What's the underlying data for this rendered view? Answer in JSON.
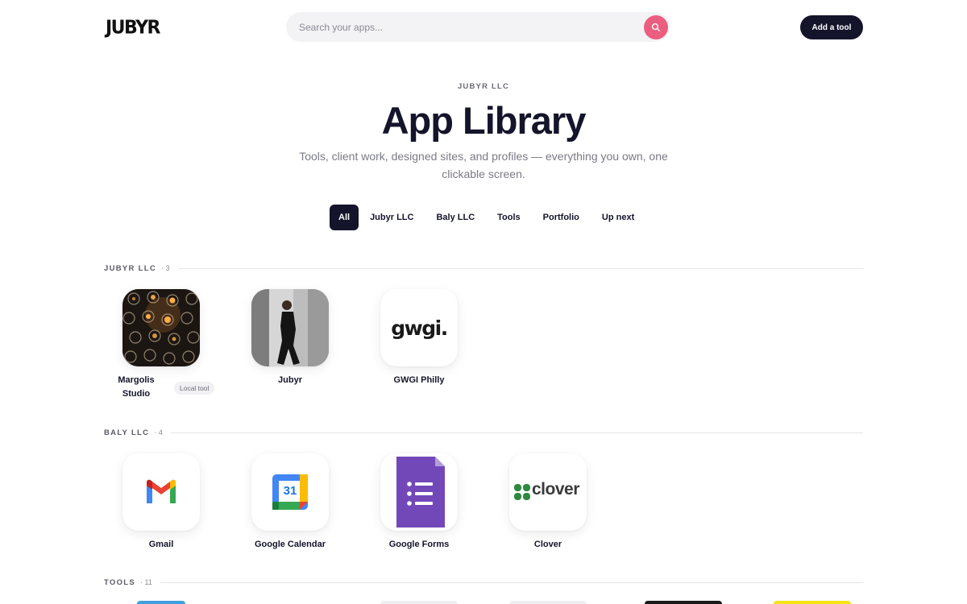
{
  "header": {
    "logo": "JUBYR",
    "search_placeholder": "Search your apps...",
    "add_button": "Add a tool"
  },
  "hero": {
    "eyebrow": "JUBYR LLC",
    "title": "App Library",
    "subtitle": "Tools, client work, designed sites, and profiles — everything you own, one clickable screen."
  },
  "filters": [
    {
      "label": "All",
      "active": true
    },
    {
      "label": "Jubyr LLC",
      "active": false
    },
    {
      "label": "Baly LLC",
      "active": false
    },
    {
      "label": "Tools",
      "active": false
    },
    {
      "label": "Portfolio",
      "active": false
    },
    {
      "label": "Up next",
      "active": false
    }
  ],
  "sections": [
    {
      "title": "JUBYR LLC",
      "count": "· 3",
      "apps": [
        {
          "name": "Margolis Studio",
          "badge": "Local tool"
        },
        {
          "name": "Jubyr"
        },
        {
          "name": "GWGI Philly",
          "logo_text": "gwgi."
        }
      ]
    },
    {
      "title": "BALY LLC",
      "count": "· 4",
      "apps": [
        {
          "name": "Gmail"
        },
        {
          "name": "Google Calendar",
          "icon_text": "31"
        },
        {
          "name": "Google Forms"
        },
        {
          "name": "Clover",
          "logo_text": "clover"
        }
      ]
    },
    {
      "title": "TOOLS",
      "count": "· 11",
      "apps": []
    }
  ],
  "colors": {
    "accent": "#ec5e80",
    "dark": "#14142b"
  }
}
